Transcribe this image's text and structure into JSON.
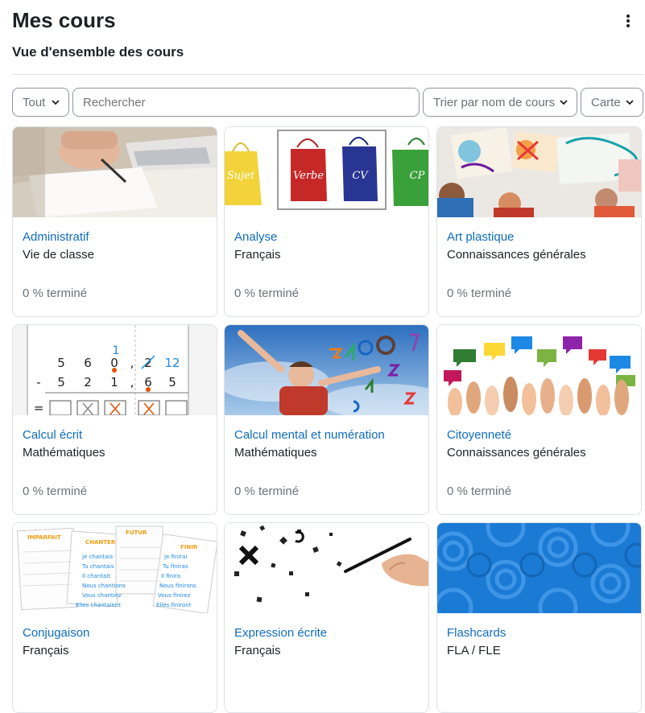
{
  "page": {
    "title": "Mes cours",
    "section_title": "Vue d'ensemble des cours"
  },
  "filters": {
    "grouping": "Tout",
    "search_placeholder": "Rechercher",
    "sort": "Trier par nom de cours",
    "view": "Carte"
  },
  "courses": [
    {
      "name": "Administratif",
      "category": "Vie de classe",
      "progress": "0 % terminé"
    },
    {
      "name": "Analyse",
      "category": "Français",
      "progress": "0 % terminé",
      "image_labels": [
        "Sujet",
        "Verbe",
        "CV",
        "CP"
      ]
    },
    {
      "name": "Art plastique",
      "category": "Connaissances générales",
      "progress": "0 % terminé"
    },
    {
      "name": "Calcul écrit",
      "category": "Mathématiques",
      "progress": "0 % terminé",
      "image_digits": {
        "row1": [
          "5",
          "6",
          "0",
          ",",
          "2",
          "12"
        ],
        "carry": "1",
        "row2": [
          "-",
          "5",
          "2",
          "1",
          ",",
          "6",
          "5"
        ],
        "row3_sign": "="
      }
    },
    {
      "name": "Calcul mental et numération",
      "category": "Mathématiques",
      "progress": "0 % terminé"
    },
    {
      "name": "Citoyenneté",
      "category": "Connaissances générales",
      "progress": "0 % terminé"
    },
    {
      "name": "Conjugaison",
      "category": "Français",
      "progress": "",
      "image_labels": [
        "IMPARFAIT",
        "CHANTER",
        "FUTUR",
        "FINIR",
        "je chantais",
        "Tu chantais",
        "Il chantait",
        "Nous chantions",
        "Vous chantiez",
        "Elles chantaient",
        "je finirai",
        "Tu finiras",
        "Il finira",
        "Nous finirons",
        "Vous finirez",
        "Elles finiront"
      ]
    },
    {
      "name": "Expression écrite",
      "category": "Français",
      "progress": ""
    },
    {
      "name": "Flashcards",
      "category": "FLA / FLE",
      "progress": ""
    }
  ],
  "colors": {
    "link": "#0f6cbf",
    "text": "#1d2125",
    "muted": "#6a737b",
    "border": "#dee2e6",
    "flashcards_bg": "#1a7ad4"
  }
}
